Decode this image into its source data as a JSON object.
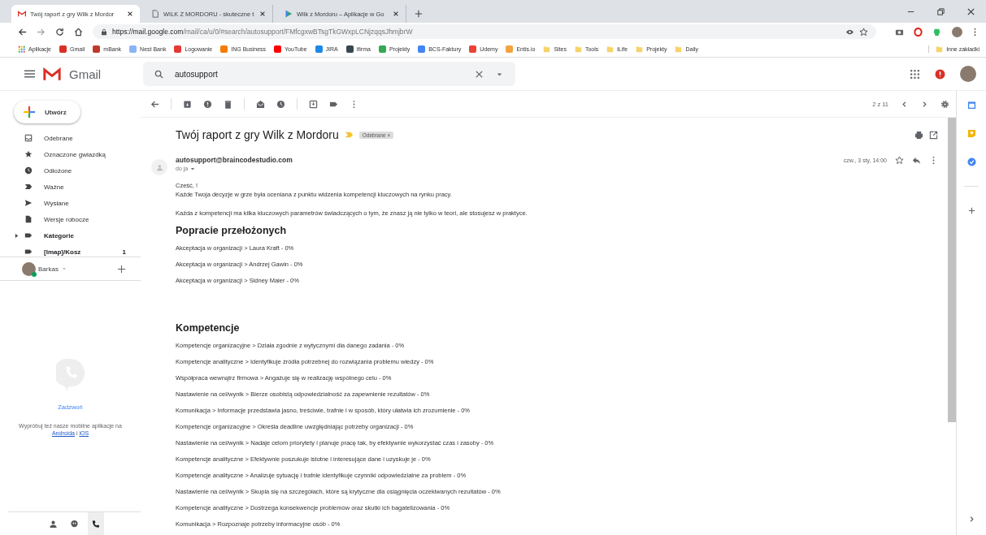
{
  "browser": {
    "tabs": [
      {
        "title": "Twój raport z gry Wilk z Mordor",
        "selected": true,
        "kind": "gmail"
      },
      {
        "title": "WILK Z MORDORU - skuteczne t",
        "selected": false,
        "kind": "page"
      },
      {
        "title": "Wilk z Mordoru – Aplikacje w Go",
        "selected": false,
        "kind": "play"
      }
    ],
    "url_host": "https://mail.google.com",
    "url_path": "/mail/ca/u/0/#search/autosupport/FMfcgxwBTsgTkGWxpLCNjzqqsJhmjbrW",
    "bookmarks": [
      {
        "label": "Aplikacje",
        "kind": "apps"
      },
      {
        "label": "Gmail",
        "kind": "site",
        "color": "#d93025"
      },
      {
        "label": "mBank",
        "kind": "site",
        "color": "#c0392b"
      },
      {
        "label": "Nest Bank",
        "kind": "site",
        "color": "#8ab4f8"
      },
      {
        "label": "Logowanie",
        "kind": "site",
        "color": "#e53935"
      },
      {
        "label": "ING Business",
        "kind": "site",
        "color": "#f57c00"
      },
      {
        "label": "YouTube",
        "kind": "site",
        "color": "#ff0000"
      },
      {
        "label": "JIRA",
        "kind": "site",
        "color": "#1e88e5"
      },
      {
        "label": "ifirma",
        "kind": "site",
        "color": "#37474f"
      },
      {
        "label": "Projekty",
        "kind": "site",
        "color": "#34a853"
      },
      {
        "label": "BCS-Faktury",
        "kind": "site",
        "color": "#4285f4"
      },
      {
        "label": "Udemy",
        "kind": "site",
        "color": "#ea4335"
      },
      {
        "label": "Entis.io",
        "kind": "site",
        "color": "#f4a340"
      },
      {
        "label": "Sites",
        "kind": "folder"
      },
      {
        "label": "Tools",
        "kind": "folder"
      },
      {
        "label": "iLife",
        "kind": "folder"
      },
      {
        "label": "Projekty",
        "kind": "folder"
      },
      {
        "label": "Daily",
        "kind": "folder"
      }
    ],
    "other_bookmarks": "Inne zakładki"
  },
  "gmail": {
    "logo_text": "Gmail",
    "search_value": "autosupport",
    "compose": "Utwórz",
    "folders": [
      {
        "label": "Odebrane",
        "bold": false,
        "expandable": false
      },
      {
        "label": "Oznaczone gwiazdką",
        "bold": false,
        "expandable": false
      },
      {
        "label": "Odłożone",
        "bold": false,
        "expandable": false
      },
      {
        "label": "Ważne",
        "bold": false,
        "expandable": false
      },
      {
        "label": "Wysłane",
        "bold": false,
        "expandable": false
      },
      {
        "label": "Wersje robocze",
        "bold": false,
        "expandable": false
      },
      {
        "label": "Kategorie",
        "bold": true,
        "expandable": true
      },
      {
        "label": "[Imap]/Kosz",
        "bold": true,
        "expandable": false,
        "count": "1"
      }
    ],
    "hangouts_user": "Barkas",
    "call": {
      "title": "Zadzwoń",
      "text": "Wypróbuj też nasze mobilne aplikacje na",
      "link_android": "Androida",
      "conjunction": "i",
      "link_ios": "iOS"
    },
    "bottom_tabs": [
      {
        "selected": false
      },
      {
        "selected": false
      },
      {
        "selected": true
      }
    ],
    "pager": "2 z 11"
  },
  "message": {
    "subject": "Twój raport z gry Wilk z Mordoru",
    "label": "Odebrane",
    "label_close": "×",
    "sender": "autosupport@braincodestudio.com",
    "recipient": "do ja",
    "date": "czw., 3 sty, 14:00",
    "greeting": "Cześć, !",
    "intro": "Każde Twoja decyzje w grze była oceniana z punktu widzenia kompetencji kluczowych na rynku pracy.",
    "intro2": "Każda z kompetencji ma kilka kluczowych parametrów świadczących o tym, że znasz ją nie tylko w teori, ale stosujesz w praktyce.",
    "sections": [
      {
        "heading": "Popracie przełożonych",
        "lines": [
          "Akceptacja w organizacji > Laura Kraft - 0%",
          "Akceptacja w organizacji > Andrzej Gawin - 0%",
          "Akceptacja w organizacji > Sidney Maier - 0%"
        ]
      },
      {
        "heading": "Kompetencje",
        "lines": [
          "Kompetencje organizacyjne > Działa zgodnie z wytycznymi dla danego zadania - 0%",
          "Kompetencje analityczne > Identyfikuje źródła potrzebnej do rozwiązania problemu wiedzy - 0%",
          "Współpraca wewnątrz firmowa > Angażuje się w realizację wspólnego celu - 0%",
          "Nastawienie na cel/wynik > Bierze osobistą odpowiedzialność za zapewnienie rezultatów - 0%",
          "Komunikacja > Informacje przedstawia jasno, treściwie, trafnie i w sposób, który ułatwia ich zrozumienie - 0%",
          "Kompetencje organizacyjne > Określa deadline uwzględniając potrzeby organizacji - 0%",
          "Nastawienie na cel/wynik > Nadaje celom priorytety i planuje pracę tak, by efektywnie wykorzystać czas i zasoby - 0%",
          "Kompetencje analityczne > Efektywnie poszukuje istotne i interesujące dane i uzyskuje je - 0%",
          "Kompetencje analityczne > Analizuje sytuację i trafnie identyfikuje czynniki odpowiedzialne za problem - 0%",
          "Nastawienie na cel/wynik > Skupia się na szczegółach, które są krytyczne dla osiągnięcia oczekiwanych rezultatów - 0%",
          "Kompetencje analityczne > Dostrzega konsekwencje problemów oraz skutki ich bagatelizowania - 0%",
          "Komunikacja > Rozpoznaje potrzeby informacyjne osób - 0%"
        ]
      }
    ]
  }
}
